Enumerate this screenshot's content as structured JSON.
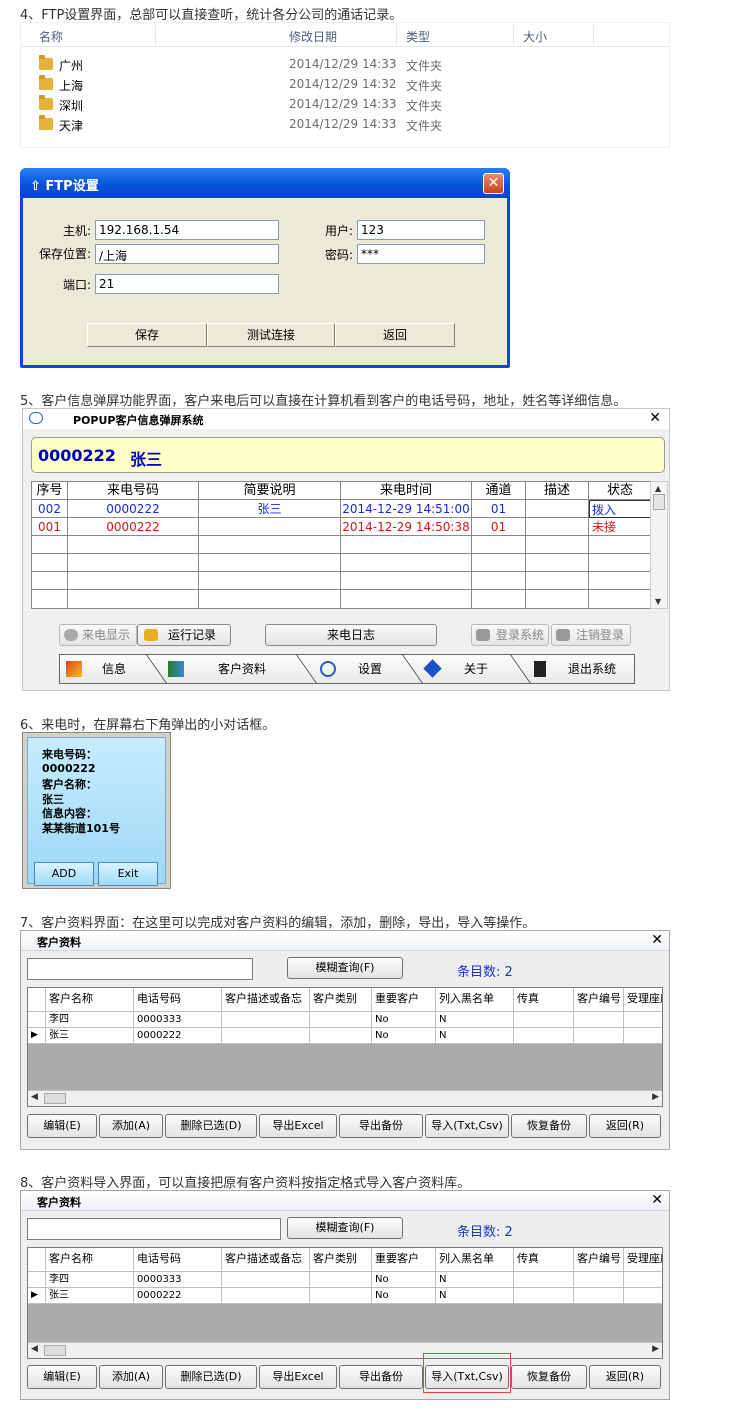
{
  "captions": {
    "c4": "4、FTP设置界面，总部可以直接查听，统计各分公司的通话记录。",
    "c5": "5、客户信息弹屏功能界面，客户来电后可以直接在计算机看到客户的电话号码，地址，姓名等详细信息。",
    "c6": "6、来电时，在屏幕右下角弹出的小对话框。",
    "c7": "7、客户资料界面：在这里可以完成对客户资料的编辑，添加，删除，导出，导入等操作。",
    "c8": "8、客户资料导入界面，可以直接把原有客户资料按指定格式导入客户资料库。"
  },
  "explorer": {
    "columns": [
      "名称",
      "修改日期",
      "类型",
      "大小"
    ],
    "rows": [
      {
        "name": "广州",
        "date": "2014/12/29 14:33",
        "type": "文件夹"
      },
      {
        "name": "上海",
        "date": "2014/12/29 14:32",
        "type": "文件夹"
      },
      {
        "name": "深圳",
        "date": "2014/12/29 14:33",
        "type": "文件夹"
      },
      {
        "name": "天津",
        "date": "2014/12/29 14:33",
        "type": "文件夹"
      }
    ]
  },
  "ftp": {
    "title": "FTP设置",
    "host_label": "主机:",
    "host_value": "192.168.1.54",
    "path_label": "保存位置:",
    "path_value": "/上海",
    "port_label": "端口:",
    "port_value": "21",
    "user_label": "用户:",
    "user_value": "123",
    "pass_label": "密码:",
    "pass_value": "***",
    "save": "保存",
    "test": "测试连接",
    "back": "返回"
  },
  "popup": {
    "title": "POPUP客户信息弹屏系统",
    "caller_number": "0000222",
    "caller_name": "张三",
    "columns": [
      "序号",
      "来电号码",
      "简要说明",
      "来电时间",
      "通道",
      "描述",
      "状态"
    ],
    "rows": [
      {
        "no": "002",
        "number": "0000222",
        "desc": "张三",
        "time": "2014-12-29 14:51:00",
        "channel": "01",
        "note": "",
        "status": "拨入",
        "color": "#1a2ad8"
      },
      {
        "no": "001",
        "number": "0000222",
        "desc": "",
        "time": "2014-12-29 14:50:38",
        "channel": "01",
        "note": "",
        "status": "未接",
        "color": "#d01818"
      }
    ],
    "buttons": {
      "display": "来电显示",
      "runlog": "运行记录",
      "calllog": "来电日志",
      "login": "登录系统",
      "logout": "注销登录"
    },
    "tabs": [
      "信息",
      "客户资料",
      "设置",
      "关于",
      "退出系统"
    ]
  },
  "notify": {
    "number_label": "来电号码：",
    "number": "0000222",
    "name_label": "客户名称：",
    "name": "张三",
    "info_label": "信息内容：",
    "info": "某某街道101号",
    "add": "ADD",
    "exit": "Exit"
  },
  "customer": {
    "title": "客户资料",
    "query": "模糊查询(F)",
    "count": "条目数: 2",
    "columns": [
      "客户名称",
      "电话号码",
      "客户描述或备忘",
      "客户类别",
      "重要客户",
      "列入黑名单",
      "传真",
      "客户编号",
      "受理座席"
    ],
    "rows": [
      {
        "name": "李四",
        "phone": "0000333",
        "important": "No",
        "blacklist": "N"
      },
      {
        "name": "张三",
        "phone": "0000222",
        "important": "No",
        "blacklist": "N"
      }
    ],
    "buttons": [
      "编辑(E)",
      "添加(A)",
      "删除已选(D)",
      "导出Excel",
      "导出备份",
      "导入(Txt,Csv)",
      "恢复备份",
      "返回(R)"
    ]
  },
  "colors": {
    "xp_blue": "#0a4bd6",
    "caller_yellow": "#ffffc8",
    "count_blue": "#1a36c8",
    "highlight_red": "#e04848"
  }
}
